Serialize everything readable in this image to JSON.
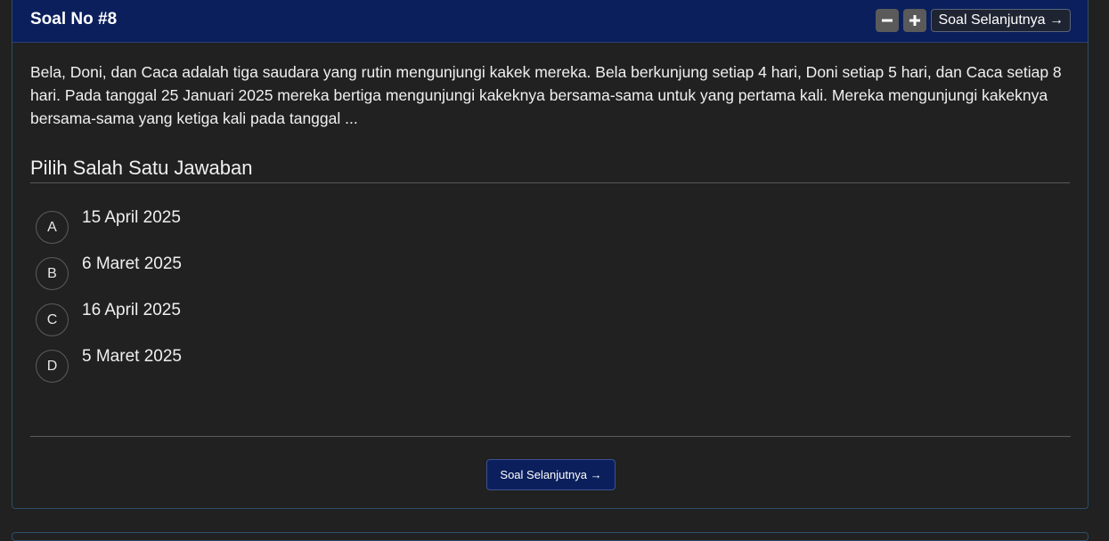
{
  "header": {
    "title": "Soal No #8",
    "minus_icon": "minus-icon",
    "plus_icon": "plus-icon",
    "next_label": "Soal Selanjutnya →"
  },
  "question": {
    "text": "Bela, Doni, dan Caca adalah tiga saudara yang rutin mengunjungi kakek mereka. Bela berkunjung setiap 4 hari, Doni setiap 5 hari, dan Caca setiap 8 hari. Pada tanggal 25 Januari 2025 mereka bertiga mengunjungi kakeknya bersama-sama untuk yang pertama kali. Mereka mengunjungi kakeknya bersama-sama yang ketiga kali pada tanggal ..."
  },
  "answers": {
    "heading": "Pilih Salah Satu Jawaban",
    "options": [
      {
        "letter": "A",
        "text": "15 April 2025"
      },
      {
        "letter": "B",
        "text": "6 Maret 2025"
      },
      {
        "letter": "C",
        "text": "16 April 2025"
      },
      {
        "letter": "D",
        "text": "5 Maret 2025"
      }
    ]
  },
  "footer": {
    "next_label": "Soal Selanjutnya →"
  },
  "colors": {
    "header_bg": "#0a1f5c",
    "page_bg": "#212121",
    "text": "#f0f0f0"
  }
}
